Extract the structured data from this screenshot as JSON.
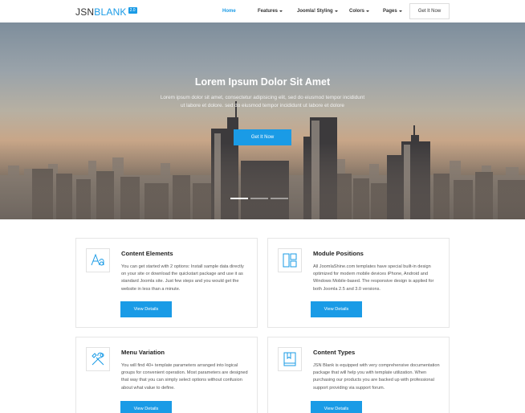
{
  "logo": {
    "text_part1": "JSN",
    "text_part2": "BLANK",
    "badge": "2.0"
  },
  "nav": {
    "items": [
      {
        "label": "Home",
        "active": true,
        "dropdown": false
      },
      {
        "label": "Features",
        "active": false,
        "dropdown": true
      },
      {
        "label": "Joomla! Styling",
        "active": false,
        "dropdown": true
      },
      {
        "label": "Colors",
        "active": false,
        "dropdown": true
      },
      {
        "label": "Pages",
        "active": false,
        "dropdown": true
      }
    ],
    "cta": "Get It Now"
  },
  "hero": {
    "title": "Lorem Ipsum Dolor Sit Amet",
    "subtitle_line1": "Lorem ipsum dolor sit amet, consectetur adipisicing elit, sed do eiusmod tempor incididunt",
    "subtitle_line2": "ut labore et dolore. sed do eiusmod tempor incididunt ut labore et dolore",
    "button": "Get It Now",
    "slides": 3,
    "active_slide": 1
  },
  "cards": [
    {
      "icon": "font-icon",
      "title": "Content Elements",
      "desc": "You can get started with 2 options: Install sample data directly on your site or download the quickstart package and use it as standard Joomla site. Just few steps and you would get the website in less than a minute.",
      "button": "View Details"
    },
    {
      "icon": "layout-icon",
      "title": "Module Positions",
      "desc": "All JoomlaShine.com templates have special built-in design optimized for modern mobile devices iPhone, Android and Windows Mobile-based. The responsive design is applied for both Joomla 2.5 and 3.0 versions.",
      "button": "View Details"
    },
    {
      "icon": "tools-icon",
      "title": "Menu Variation",
      "desc": "You will find 40+ template parameters arranged into logical groups for convenient operation. Most parameters are designed that way that you can simply select options without confusion about what value to define.",
      "button": "View Details"
    },
    {
      "icon": "book-icon",
      "title": "Content Types",
      "desc": "JSN Blank is equipped with very comprehensive documentation package that will help you with template utilization. When purchasing our products you are backed up with professional support providing via support forum.",
      "button": "View Details"
    }
  ],
  "colors": {
    "accent": "#1a9be6"
  }
}
